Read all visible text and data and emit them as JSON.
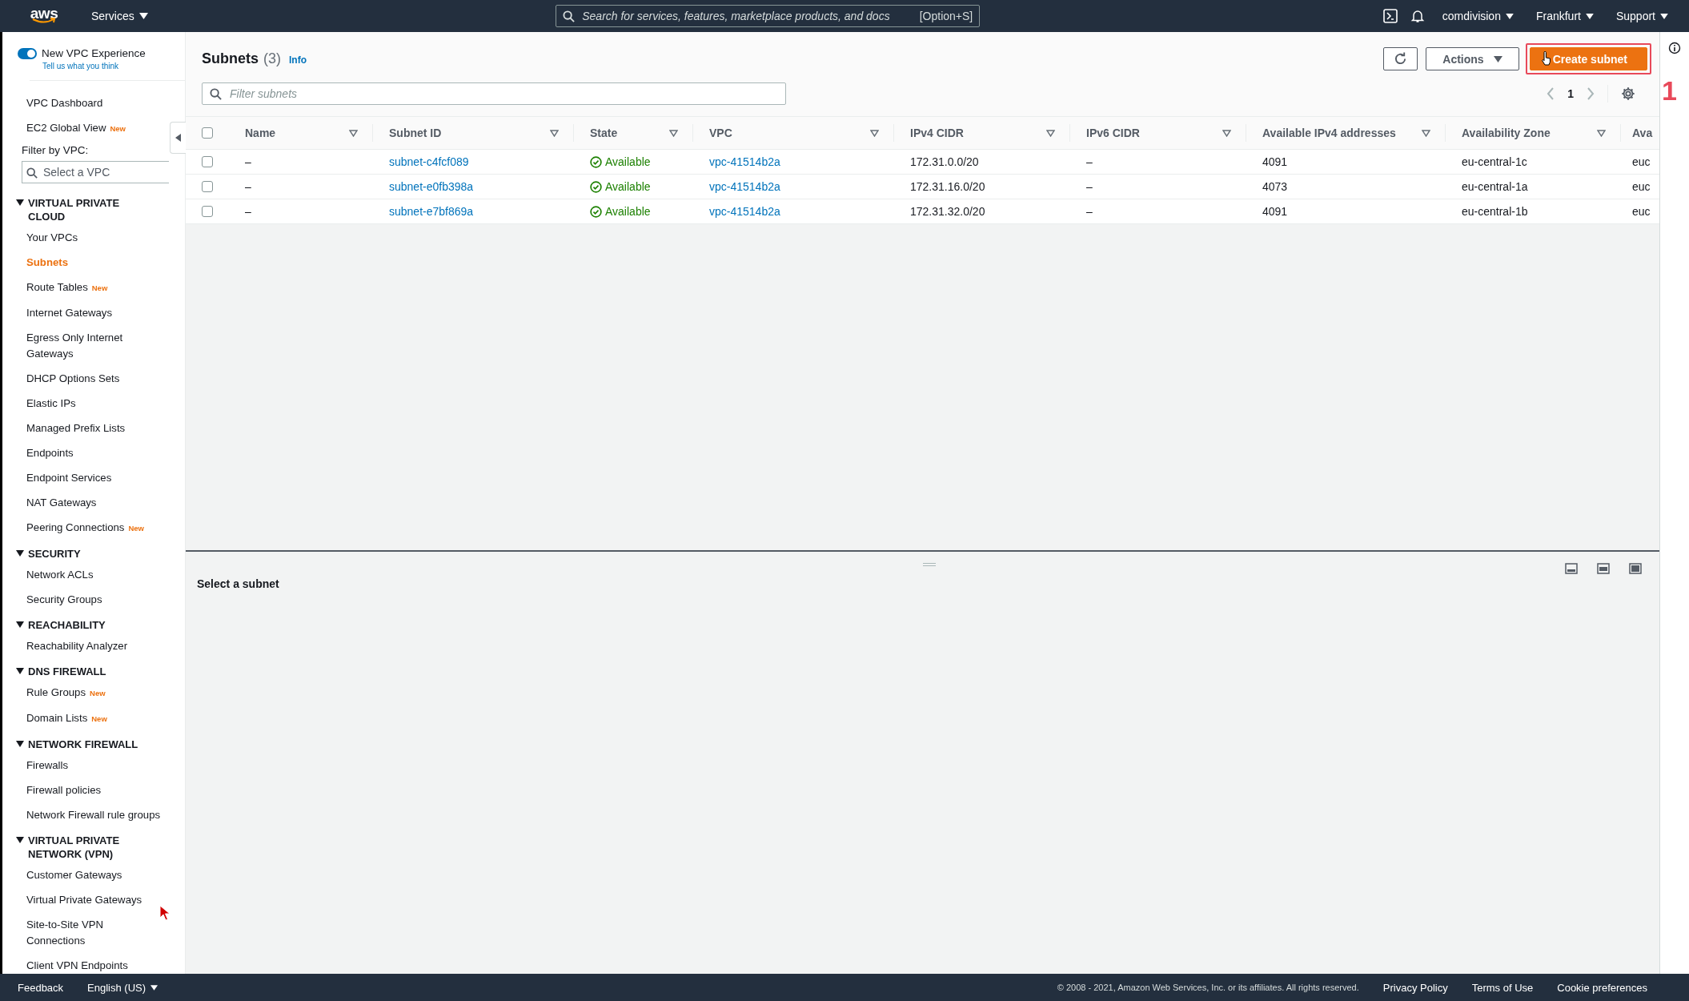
{
  "top_bar": {
    "logo": "aws",
    "services": "Services",
    "search_placeholder": "Search for services, features, marketplace products, and docs",
    "search_shortcut": "[Option+S]",
    "menus": [
      "comdivision",
      "Frankfurt",
      "Support"
    ]
  },
  "sidebar": {
    "toggle": {
      "label": "New VPC Experience",
      "on": true
    },
    "feedback_link": "Tell us what you think",
    "top_items": [
      {
        "label": "VPC Dashboard"
      },
      {
        "label": "EC2 Global View",
        "badge": "New"
      }
    ],
    "filter_label": "Filter by VPC:",
    "filter_placeholder": "Select a VPC",
    "sections": [
      {
        "title": "VIRTUAL PRIVATE CLOUD",
        "expanded": true,
        "items": [
          {
            "label": "Your VPCs",
            "selected": false
          },
          {
            "label": "Subnets",
            "selected": true
          },
          {
            "label": "Route Tables",
            "badge": "New",
            "selected": false
          },
          {
            "label": "Internet Gateways",
            "selected": false
          },
          {
            "label": "Egress Only Internet Gateways",
            "selected": false
          },
          {
            "label": "DHCP Options Sets",
            "selected": false
          },
          {
            "label": "Elastic IPs",
            "selected": false
          },
          {
            "label": "Managed Prefix Lists",
            "selected": false
          },
          {
            "label": "Endpoints",
            "selected": false
          },
          {
            "label": "Endpoint Services",
            "selected": false
          },
          {
            "label": "NAT Gateways",
            "selected": false
          },
          {
            "label": "Peering Connections",
            "badge": "New",
            "selected": false
          }
        ]
      },
      {
        "title": "SECURITY",
        "expanded": true,
        "items": [
          {
            "label": "Network ACLs",
            "selected": false
          },
          {
            "label": "Security Groups",
            "selected": false
          }
        ]
      },
      {
        "title": "REACHABILITY",
        "expanded": true,
        "items": [
          {
            "label": "Reachability Analyzer",
            "selected": false
          }
        ]
      },
      {
        "title": "DNS FIREWALL",
        "expanded": true,
        "items": [
          {
            "label": "Rule Groups",
            "badge": "New",
            "selected": false
          },
          {
            "label": "Domain Lists",
            "badge": "New",
            "selected": false
          }
        ]
      },
      {
        "title": "NETWORK FIREWALL",
        "expanded": true,
        "items": [
          {
            "label": "Firewalls",
            "selected": false
          },
          {
            "label": "Firewall policies",
            "selected": false
          },
          {
            "label": "Network Firewall rule groups",
            "selected": false
          }
        ]
      },
      {
        "title": "VIRTUAL PRIVATE NETWORK (VPN)",
        "expanded": true,
        "items": [
          {
            "label": "Customer Gateways",
            "selected": false
          },
          {
            "label": "Virtual Private Gateways",
            "selected": false
          },
          {
            "label": "Site-to-Site VPN Connections",
            "selected": false
          },
          {
            "label": "Client VPN Endpoints",
            "selected": false
          }
        ]
      }
    ]
  },
  "main": {
    "title": "Subnets",
    "count": "(3)",
    "info": "Info",
    "actions": "Actions",
    "create_button": "Create subnet",
    "filter_placeholder": "Filter subnets",
    "page": "1",
    "table": {
      "select_all_checked": false,
      "columns": [
        "Name",
        "Subnet ID",
        "State",
        "VPC",
        "IPv4 CIDR",
        "IPv6 CIDR",
        "Available IPv4 addresses",
        "Availability Zone",
        "Ava"
      ],
      "rows": [
        {
          "checked": false,
          "name": "–",
          "subnet_id": "subnet-c4fcf089",
          "state": "Available",
          "vpc": "vpc-41514b2a",
          "ipv4_cidr": "172.31.0.0/20",
          "ipv6_cidr": "–",
          "available_ipv4": "4091",
          "availability_zone": "eu-central-1c",
          "column_9": "euc"
        },
        {
          "checked": false,
          "name": "–",
          "subnet_id": "subnet-e0fb398a",
          "state": "Available",
          "vpc": "vpc-41514b2a",
          "ipv4_cidr": "172.31.16.0/20",
          "ipv6_cidr": "–",
          "available_ipv4": "4073",
          "availability_zone": "eu-central-1a",
          "column_9": "euc"
        },
        {
          "checked": false,
          "name": "–",
          "subnet_id": "subnet-e7bf869a",
          "state": "Available",
          "vpc": "vpc-41514b2a",
          "ipv4_cidr": "172.31.32.0/20",
          "ipv6_cidr": "–",
          "available_ipv4": "4091",
          "availability_zone": "eu-central-1b",
          "column_9": "euc"
        }
      ]
    },
    "split_panel": {
      "message": "Select a subnet"
    },
    "annotation": {
      "label": "1"
    }
  },
  "footer": {
    "feedback": "Feedback",
    "language": "English (US)",
    "copyright": "© 2008 - 2021, Amazon Web Services, Inc. or its affiliates. All rights reserved.",
    "links": [
      "Privacy Policy",
      "Terms of Use",
      "Cookie preferences"
    ]
  }
}
